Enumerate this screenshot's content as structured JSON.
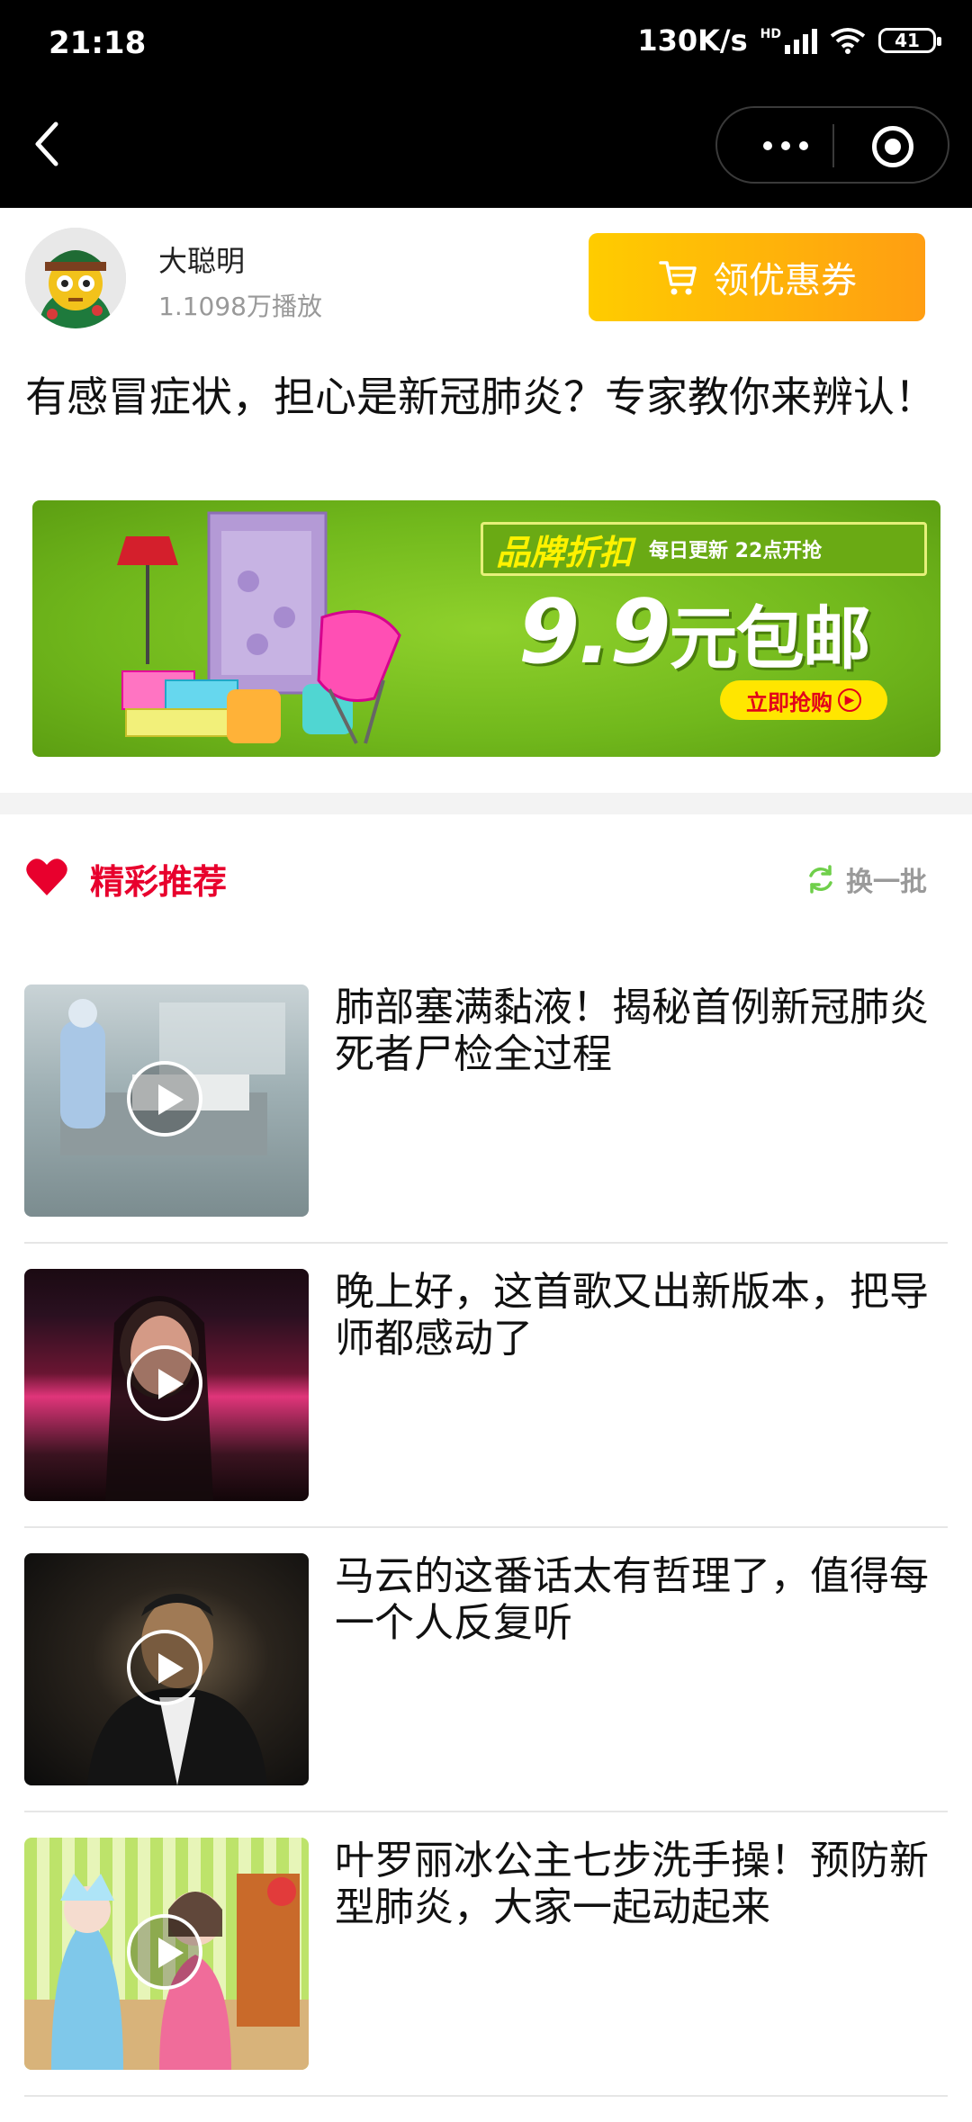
{
  "status_bar": {
    "time": "21:18",
    "network_speed": "130K/s",
    "signal_badge": "HD",
    "battery": "41"
  },
  "nav": {
    "back_icon": "chevron-left-icon",
    "more_icon": "more-dots-icon",
    "close_icon": "target-circle-icon"
  },
  "author": {
    "name": "大聪明",
    "plays": "1.1098万播放"
  },
  "coupon_button": {
    "label": "领优惠券",
    "icon": "cart-icon"
  },
  "article_title": "有感冒症状，担心是新冠肺炎？专家教你来辨认！",
  "banner": {
    "tag": "品牌折扣",
    "tag_sub": "每日更新 22点开抢",
    "price": "9.9",
    "price_unit": "元包邮",
    "cta": "立即抢购"
  },
  "recommend": {
    "title": "精彩推荐",
    "refresh_label": "换一批",
    "items": [
      {
        "title": "肺部塞满黏液！揭秘首例新冠肺炎死者尸检全过程"
      },
      {
        "title": "晚上好，这首歌又出新版本，把导师都感动了"
      },
      {
        "title": "马云的这番话太有哲理了，值得每一个人反复听"
      },
      {
        "title": "叶罗丽冰公主七步洗手操！预防新型肺炎，大家一起动起来"
      }
    ]
  },
  "colors": {
    "accent_red": "#e8002d",
    "coupon_gradient_start": "#ffcc00",
    "coupon_gradient_end": "#ff9e12",
    "banner_green": "#71b81c"
  }
}
